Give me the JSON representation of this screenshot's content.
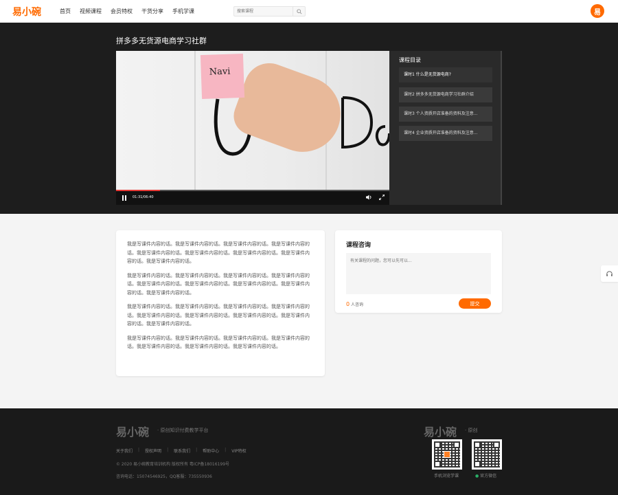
{
  "header": {
    "logo": "易小碗",
    "nav": [
      "首页",
      "视频课程",
      "会员特权",
      "干货分享",
      "手机学课"
    ],
    "search_placeholder": "搜索课程",
    "avatar_letter": "易"
  },
  "video": {
    "course_title": "拼多多无货源电商学习社群",
    "sticky_text": "Navi",
    "time": "01:31/06:40",
    "progress": 0.16,
    "catalog_title": "课程目录",
    "catalog": [
      "课时1 什么是无货源电商?",
      "课时2 拼多多无货源电商学习社群介绍",
      "课时3 个人资质开店准备的资料及注意...",
      "课时4 企业资质开店准备的资料及注意..."
    ]
  },
  "content": {
    "paragraphs": [
      "我是写课件内容的话。我是写课件内容的话。我是写课件内容的话。我是写课件内容的话。我是写课件内容的话。我是写课件内容的话。我是写课件内容的话。我是写课件内容的话。我是写课件内容的话。",
      "我是写课件内容的话。我是写课件内容的话。我是写课件内容的话。我是写课件内容的话。我是写课件内容的话。我是写课件内容的话。我是写课件内容的话。我是写课件内容的话。我是写课件内容的话。",
      "我是写课件内容的话。我是写课件内容的话。我是写课件内容的话。我是写课件内容的话。我是写课件内容的话。我是写课件内容的话。我是写课件内容的话。我是写课件内容的话。我是写课件内容的话。",
      "我是写课件内容的话。我是写课件内容的话。我是写课件内容的话。我是写课件内容的话。我是写课件内容的话。我是写课件内容的话。我是写课件内容的话。"
    ]
  },
  "consult": {
    "title": "课程咨询",
    "placeholder": "有关课程的问题，您可以先可以...",
    "count": "0",
    "count_label": "人咨询",
    "submit": "提交"
  },
  "footer": {
    "logo": "易小碗",
    "slogan": "· 原创知识付费教学平台",
    "links": [
      "关于我们",
      "授权声明",
      "联系我们",
      "帮助中心",
      "VIP特权"
    ],
    "copyright": "© 2020 易小碗教育培训机构 版权所有 粤ICP备18016199号",
    "contact": "咨询电话：15074546925，QQ客服：735550936",
    "logo2": "易小碗",
    "slogan2": "· 原创",
    "qr_labels": [
      "手机浏览学课",
      "官方微信"
    ]
  },
  "colors": {
    "accent": "#ff6a00",
    "dark_band": "#1d1d1d",
    "footer": "#1a1a1a",
    "progress": "#e53935"
  }
}
